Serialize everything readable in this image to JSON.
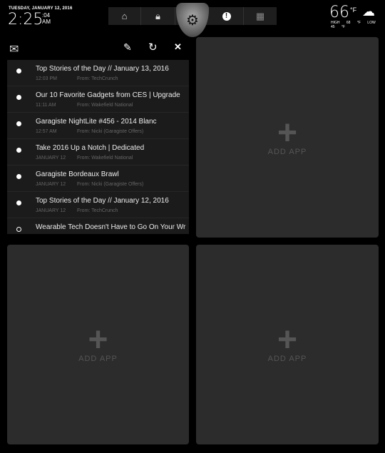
{
  "clock": {
    "date": "TUESDAY, JANUARY 12, 2016",
    "time": "2:25",
    "seconds": ":04",
    "ampm": "AM"
  },
  "toolbar": {
    "icons": [
      "garage-icon",
      "lock-icon",
      "gear-icon",
      "alert-icon",
      "grid-icon"
    ]
  },
  "weather": {
    "temp": "66",
    "unit": "°F",
    "high": "HIGH 68 °F",
    "low": "LOW 45 °F",
    "icon": "snow-cloud-icon"
  },
  "mail": {
    "icons": [
      "mail-icon",
      "compose-icon",
      "refresh-icon",
      "close-icon"
    ],
    "items": [
      {
        "subject": "Top Stories of the Day // January 13, 2016",
        "time": "12:03 PM",
        "from": "From: TechCrunch",
        "read": false
      },
      {
        "subject": "Our 10 Favorite Gadgets from CES | Upgrade",
        "time": "11:11 AM",
        "from": "From: Wakefield National",
        "read": false
      },
      {
        "subject": "Garagiste NightLite #456 - 2014 Blanc",
        "time": "12:57 AM",
        "from": "From: Nicki (Garagiste Offers)",
        "read": false
      },
      {
        "subject": "Take 2016 Up a Notch | Dedicated",
        "time": "JANUARY 12",
        "from": "From: Wakefield National",
        "read": false
      },
      {
        "subject": "Garagiste Bordeaux Brawl",
        "time": "JANUARY 12",
        "from": "From: Nicki (Garagiste Offers)",
        "read": false
      },
      {
        "subject": "Top Stories of the Day // January 12, 2016",
        "time": "JANUARY 12",
        "from": "From: TechCrunch",
        "read": false
      },
      {
        "subject": "Wearable Tech Doesn't Have to Go On Your Wr",
        "time": "",
        "from": "",
        "read": true
      }
    ]
  },
  "add_app": {
    "label": "ADD APP",
    "plus": "+"
  }
}
